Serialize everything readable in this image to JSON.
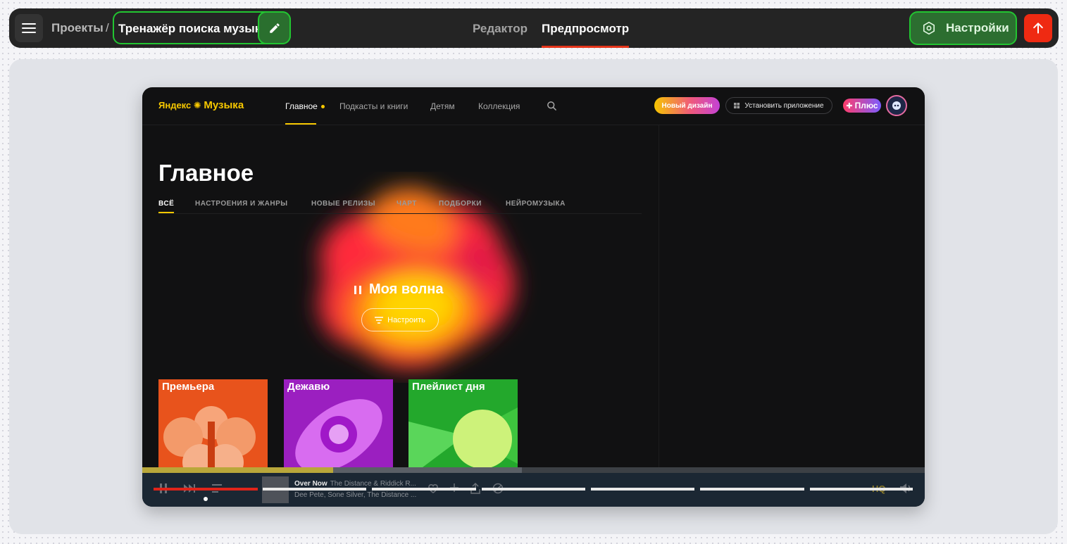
{
  "topbar": {
    "breadcrumb_root": "Проекты",
    "separator": "/",
    "project_title": "Тренажёр поиска музыки",
    "tabs": [
      {
        "label": "Редактор",
        "active": false
      },
      {
        "label": "Предпросмотр",
        "active": true
      }
    ],
    "settings_label": "Настройки",
    "icons": {
      "menu": "hamburger-icon",
      "edit": "pencil-icon",
      "settings": "hexagon-gear-icon",
      "publish": "arrow-up-icon"
    },
    "colors": {
      "accent_green": "#22c531",
      "publish_red": "#ef2a12",
      "active_tab_underline": "#e5341a"
    }
  },
  "preview": {
    "logo": {
      "left": "Яндекс",
      "right": "Музыка"
    },
    "nav": [
      {
        "label": "Главное",
        "active": true
      },
      {
        "label": "Подкасты и книги",
        "active": false
      },
      {
        "label": "Детям",
        "active": false
      },
      {
        "label": "Коллекция",
        "active": false
      }
    ],
    "new_design_label": "Новый дизайн",
    "install_app_label": "Установить приложение",
    "plus_label": "Плюс",
    "page_title": "Главное",
    "filters": [
      {
        "label": "ВСЁ",
        "active": true
      },
      {
        "label": "НАСТРОЕНИЯ И ЖАНРЫ",
        "active": false
      },
      {
        "label": "НОВЫЕ РЕЛИЗЫ",
        "active": false
      },
      {
        "label": "ЧАРТ",
        "active": false
      },
      {
        "label": "ПОДБОРКИ",
        "active": false
      },
      {
        "label": "НЕЙРОМУЗЫКА",
        "active": false
      }
    ],
    "wave": {
      "title": "Моя волна",
      "tune_label": "Настроить"
    },
    "cards": [
      {
        "title": "Премьера",
        "color": "#e8531c"
      },
      {
        "title": "Дежавю",
        "color": "#9b1fc0"
      },
      {
        "title": "Плейлист дня",
        "color": "#23a82c"
      }
    ],
    "player": {
      "track_title": "Over Now",
      "track_artist_short": "The Distance & Riddick R...",
      "track_artists": "Dee Pete, Sone Silver, The Distance ...",
      "quality_label": "HQ",
      "progress": 0.244
    }
  }
}
